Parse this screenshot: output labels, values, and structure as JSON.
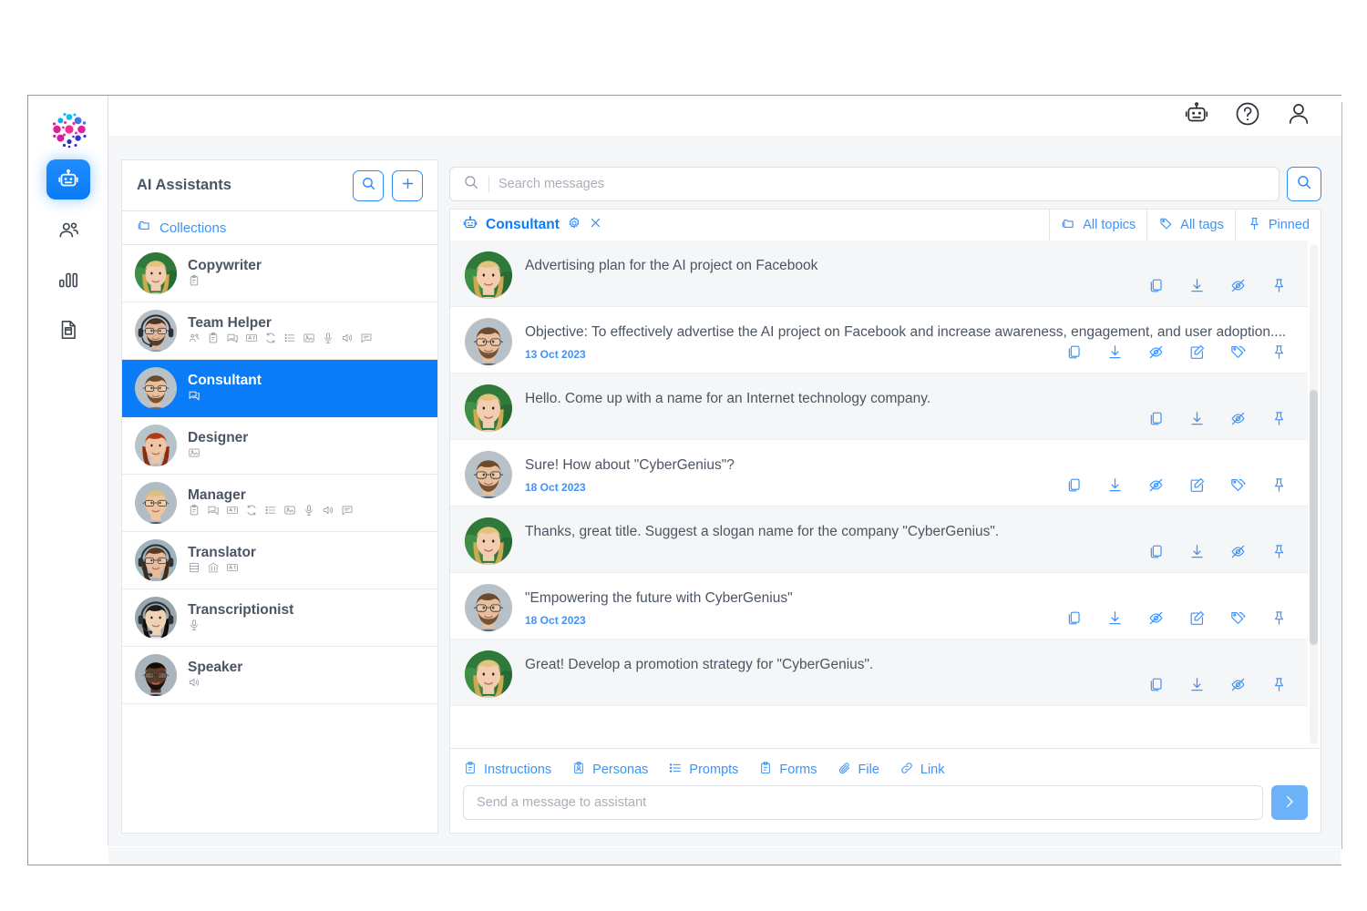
{
  "app": {
    "logo_name": "particle-logo",
    "accent": "#0b7cf7",
    "accent_light": "#3d93f8",
    "text_grey": "#4b5563",
    "panel_bg": "#f5f6f8"
  },
  "rail": {
    "items": [
      {
        "name": "assistants",
        "icon": "robot-icon",
        "active": true
      },
      {
        "name": "team",
        "icon": "people-icon",
        "active": false
      },
      {
        "name": "analytics",
        "icon": "bar-chart-icon",
        "active": false
      },
      {
        "name": "documents",
        "icon": "document-icon",
        "active": false
      }
    ]
  },
  "topbar": {
    "icons": [
      {
        "name": "robot-icon"
      },
      {
        "name": "help-icon"
      },
      {
        "name": "user-account-icon"
      }
    ]
  },
  "assistants_panel": {
    "title": "AI Assistants",
    "search_button": "search-icon",
    "add_button": "plus-icon",
    "collections_label": "Collections",
    "items": [
      {
        "name": "Copywriter",
        "avatar": "blonde-woman",
        "caps": [
          "clipboard"
        ]
      },
      {
        "name": "Team Helper",
        "avatar": "bearded-man-headset",
        "caps": [
          "people",
          "clipboard",
          "chat",
          "translate",
          "sync",
          "list",
          "image",
          "mic",
          "speaker",
          "comment"
        ]
      },
      {
        "name": "Consultant",
        "avatar": "man-glasses-suit",
        "caps": [
          "chat"
        ],
        "selected": true
      },
      {
        "name": "Designer",
        "avatar": "red-hair-woman",
        "caps": [
          "image"
        ]
      },
      {
        "name": "Manager",
        "avatar": "blond-man-glasses",
        "caps": [
          "clipboard",
          "chat",
          "translate",
          "sync",
          "list",
          "image",
          "mic",
          "speaker",
          "comment"
        ]
      },
      {
        "name": "Translator",
        "avatar": "woman-headset-glasses",
        "caps": [
          "database",
          "bank",
          "translate"
        ]
      },
      {
        "name": "Transcriptionist",
        "avatar": "asian-woman-headset",
        "caps": [
          "mic"
        ]
      },
      {
        "name": "Speaker",
        "avatar": "dark-man-suit",
        "caps": [
          "speaker"
        ]
      }
    ]
  },
  "search": {
    "placeholder": "Search messages",
    "value": "",
    "icon": "search-icon",
    "go_button": "search-icon"
  },
  "chat_tabbar": {
    "active_tab": "Consultant",
    "tab_icon": "robot-icon",
    "settings_icon": "gear-icon",
    "close_icon": "close-icon",
    "filters": [
      {
        "label": "All topics",
        "icon": "folder-icon"
      },
      {
        "label": "All tags",
        "icon": "tag-icon"
      },
      {
        "label": "Pinned",
        "icon": "pin-icon"
      }
    ]
  },
  "messages": [
    {
      "role": "user",
      "avatar": "blonde-woman",
      "text": "Advertising plan for the AI project on Facebook",
      "date": "",
      "actions": [
        "copy-icon",
        "download-icon",
        "hide-icon",
        "pin-icon"
      ]
    },
    {
      "role": "assistant",
      "avatar": "man-glasses-suit",
      "text": "Objective: To effectively advertise the AI project on Facebook and increase awareness, engagement, and user adoption....",
      "date": "13 Oct 2023",
      "actions": [
        "copy-icon",
        "download-icon",
        "hide-icon",
        "edit-icon",
        "tag-icon",
        "pin-icon"
      ]
    },
    {
      "role": "user",
      "avatar": "blonde-woman",
      "text": "Hello. Come up with a name for an Internet technology company.",
      "date": "",
      "actions": [
        "copy-icon",
        "download-icon",
        "hide-icon",
        "pin-icon"
      ]
    },
    {
      "role": "assistant",
      "avatar": "man-glasses-suit",
      "text": "Sure! How about \"CyberGenius\"?",
      "date": "18 Oct 2023",
      "actions": [
        "copy-icon",
        "download-icon",
        "hide-icon",
        "edit-icon",
        "tag-icon",
        "pin-icon"
      ]
    },
    {
      "role": "user",
      "avatar": "blonde-woman",
      "text": "Thanks, great title. Suggest a slogan name for the company \"CyberGenius\".",
      "date": "",
      "actions": [
        "copy-icon",
        "download-icon",
        "hide-icon",
        "pin-icon"
      ]
    },
    {
      "role": "assistant",
      "avatar": "man-glasses-suit",
      "text": "\"Empowering the future with CyberGenius\"",
      "date": "18 Oct 2023",
      "actions": [
        "copy-icon",
        "download-icon",
        "hide-icon",
        "edit-icon",
        "tag-icon",
        "pin-icon"
      ]
    },
    {
      "role": "user",
      "avatar": "blonde-woman",
      "text": "Great! Develop a promotion strategy for \"CyberGenius\".",
      "date": "",
      "actions": [
        "copy-icon",
        "download-icon",
        "hide-icon",
        "pin-icon"
      ]
    }
  ],
  "composer": {
    "tools": [
      {
        "label": "Instructions",
        "icon": "clipboard-icon"
      },
      {
        "label": "Personas",
        "icon": "persona-icon"
      },
      {
        "label": "Prompts",
        "icon": "list-icon"
      },
      {
        "label": "Forms",
        "icon": "form-icon"
      },
      {
        "label": "File",
        "icon": "paperclip-icon"
      },
      {
        "label": "Link",
        "icon": "link-icon"
      }
    ],
    "placeholder": "Send a message to assistant",
    "value": "",
    "send_icon": "chevron-right-icon"
  }
}
